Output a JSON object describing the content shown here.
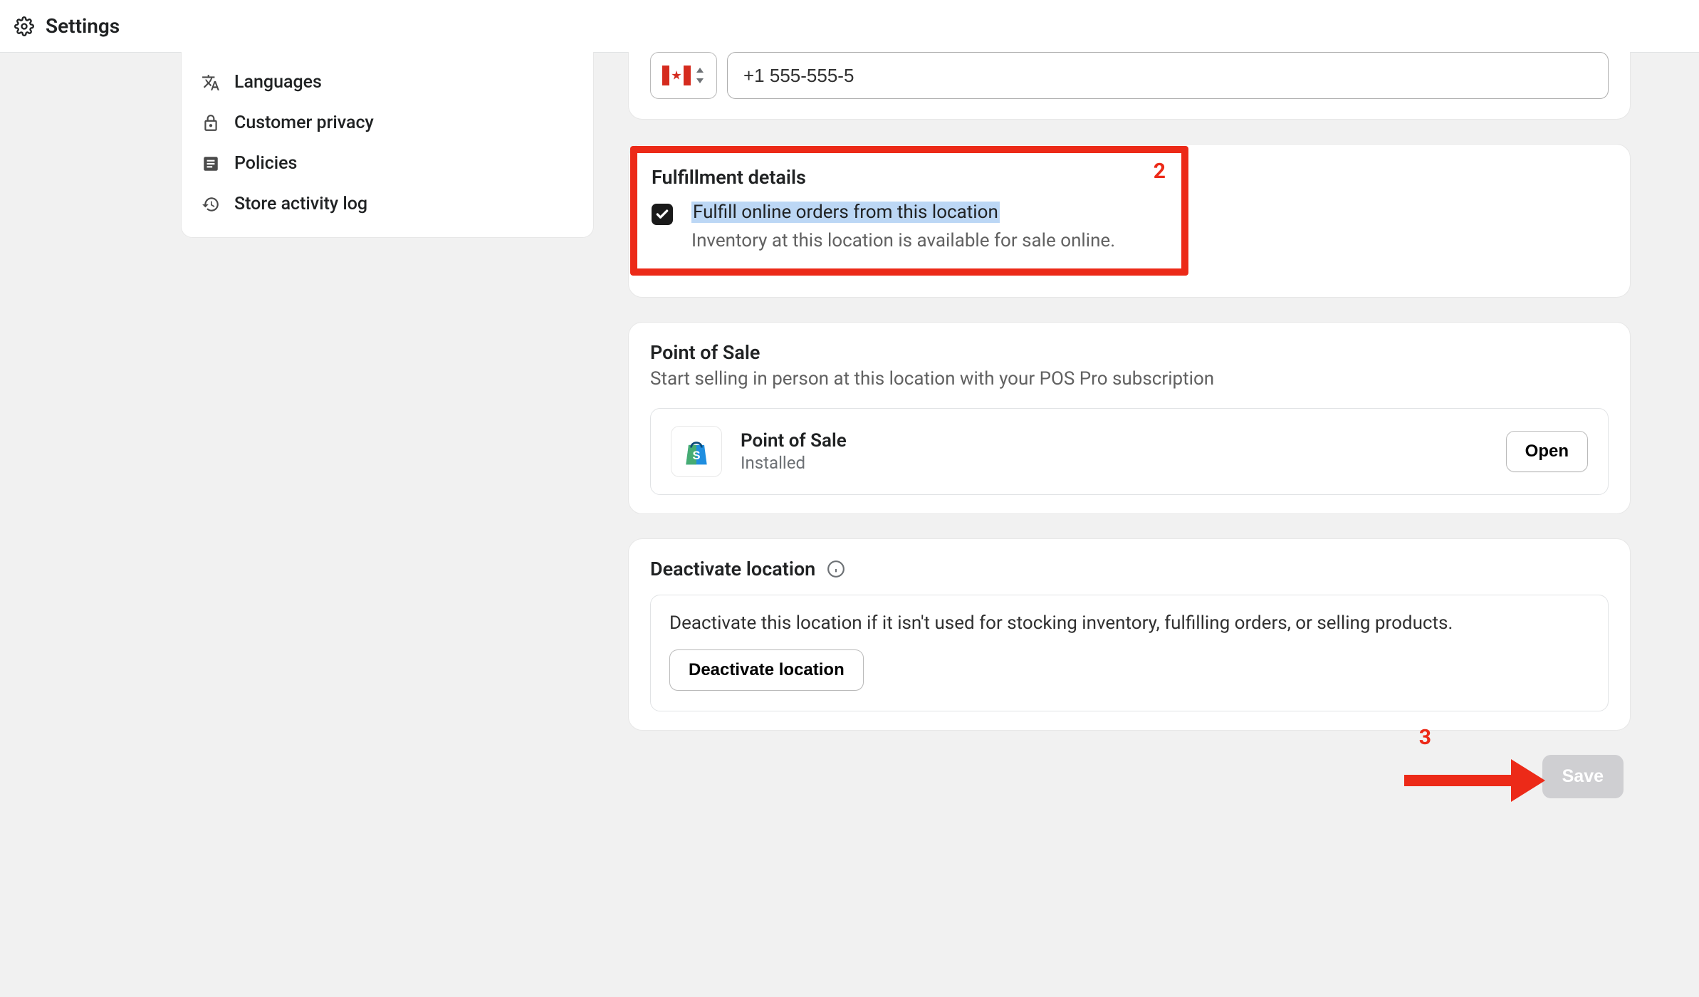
{
  "header": {
    "title": "Settings"
  },
  "sidebar": {
    "items": [
      {
        "label": "Languages"
      },
      {
        "label": "Customer privacy"
      },
      {
        "label": "Policies"
      },
      {
        "label": "Store activity log"
      }
    ]
  },
  "phone": {
    "country_code": "CA",
    "value": "+1 555-555-5"
  },
  "fulfillment": {
    "heading": "Fulfillment details",
    "checkbox_label": "Fulfill online orders from this location",
    "checkbox_sub": "Inventory at this location is available for sale online.",
    "checked": true,
    "annotation_number": "2"
  },
  "pos": {
    "heading": "Point of Sale",
    "description": "Start selling in person at this location with your POS Pro subscription",
    "app_name": "Point of Sale",
    "app_status": "Installed",
    "open_label": "Open"
  },
  "deactivate": {
    "heading": "Deactivate location",
    "description": "Deactivate this location if it isn't used for stocking inventory, fulfilling orders, or selling products.",
    "button_label": "Deactivate location"
  },
  "save": {
    "label": "Save",
    "annotation_number": "3"
  }
}
